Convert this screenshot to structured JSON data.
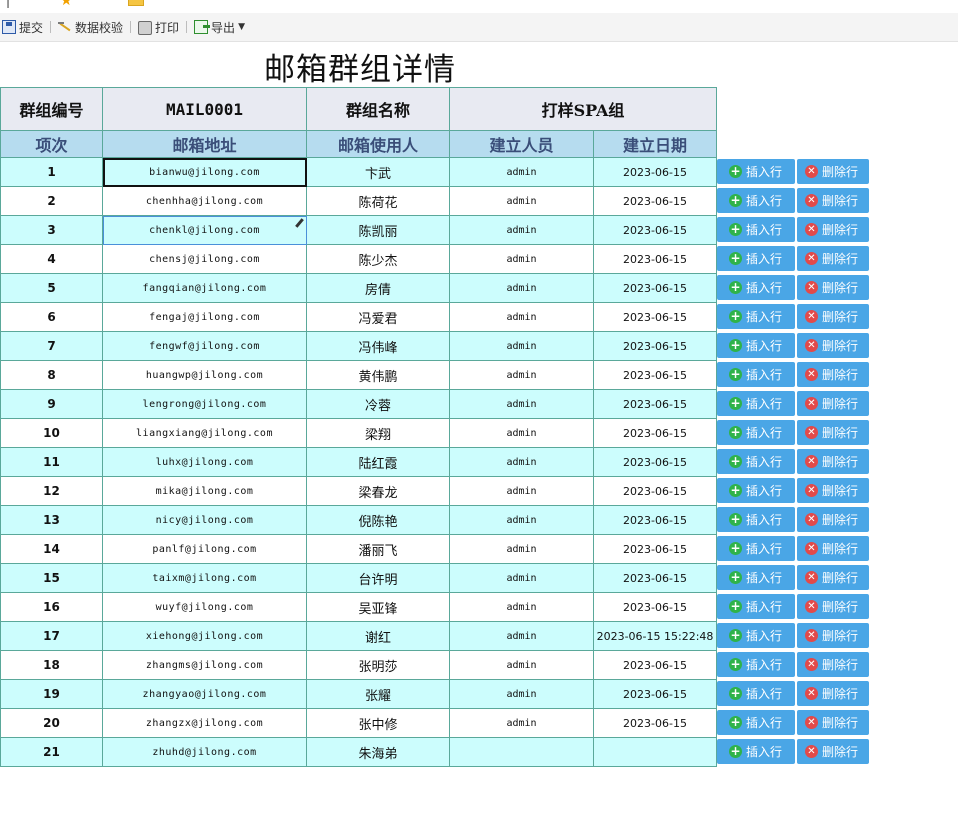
{
  "toolbar": {
    "submit_label": "提交",
    "validate_label": "数据校验",
    "print_label": "打印",
    "export_label": "导出"
  },
  "page_title": "邮箱群组详情",
  "group": {
    "id_label": "群组编号",
    "id_value": "MAIL0001",
    "name_label": "群组名称",
    "name_value": "打样SPA组"
  },
  "columns": [
    "项次",
    "邮箱地址",
    "邮箱使用人",
    "建立人员",
    "建立日期"
  ],
  "rows": [
    {
      "idx": "1",
      "email": "bianwu@jilong.com",
      "user": "卞武",
      "creator": "admin",
      "date": "2023-06-15"
    },
    {
      "idx": "2",
      "email": "chenhha@jilong.com",
      "user": "陈荷花",
      "creator": "admin",
      "date": "2023-06-15"
    },
    {
      "idx": "3",
      "email": "chenkl@jilong.com",
      "user": "陈凯丽",
      "creator": "admin",
      "date": "2023-06-15"
    },
    {
      "idx": "4",
      "email": "chensj@jilong.com",
      "user": "陈少杰",
      "creator": "admin",
      "date": "2023-06-15"
    },
    {
      "idx": "5",
      "email": "fangqian@jilong.com",
      "user": "房倩",
      "creator": "admin",
      "date": "2023-06-15"
    },
    {
      "idx": "6",
      "email": "fengaj@jilong.com",
      "user": "冯爱君",
      "creator": "admin",
      "date": "2023-06-15"
    },
    {
      "idx": "7",
      "email": "fengwf@jilong.com",
      "user": "冯伟峰",
      "creator": "admin",
      "date": "2023-06-15"
    },
    {
      "idx": "8",
      "email": "huangwp@jilong.com",
      "user": "黄伟鹏",
      "creator": "admin",
      "date": "2023-06-15"
    },
    {
      "idx": "9",
      "email": "lengrong@jilong.com",
      "user": "冷蓉",
      "creator": "admin",
      "date": "2023-06-15"
    },
    {
      "idx": "10",
      "email": "liangxiang@jilong.com",
      "user": "梁翔",
      "creator": "admin",
      "date": "2023-06-15"
    },
    {
      "idx": "11",
      "email": "luhx@jilong.com",
      "user": "陆红霞",
      "creator": "admin",
      "date": "2023-06-15"
    },
    {
      "idx": "12",
      "email": "mika@jilong.com",
      "user": "梁春龙",
      "creator": "admin",
      "date": "2023-06-15"
    },
    {
      "idx": "13",
      "email": "nicy@jilong.com",
      "user": "倪陈艳",
      "creator": "admin",
      "date": "2023-06-15"
    },
    {
      "idx": "14",
      "email": "panlf@jilong.com",
      "user": "潘丽飞",
      "creator": "admin",
      "date": "2023-06-15"
    },
    {
      "idx": "15",
      "email": "taixm@jilong.com",
      "user": "台许明",
      "creator": "admin",
      "date": "2023-06-15"
    },
    {
      "idx": "16",
      "email": "wuyf@jilong.com",
      "user": "吴亚锋",
      "creator": "admin",
      "date": "2023-06-15"
    },
    {
      "idx": "17",
      "email": "xiehong@jilong.com",
      "user": "谢红",
      "creator": "admin",
      "date": "2023-06-15 15:22:48"
    },
    {
      "idx": "18",
      "email": "zhangms@jilong.com",
      "user": "张明莎",
      "creator": "admin",
      "date": "2023-06-15"
    },
    {
      "idx": "19",
      "email": "zhangyao@jilong.com",
      "user": "张耀",
      "creator": "admin",
      "date": "2023-06-15"
    },
    {
      "idx": "20",
      "email": "zhangzx@jilong.com",
      "user": "张中修",
      "creator": "admin",
      "date": "2023-06-15"
    },
    {
      "idx": "21",
      "email": "zhuhd@jilong.com",
      "user": "朱海弟",
      "creator": "",
      "date": ""
    }
  ],
  "actions": {
    "insert_label": "插入行",
    "delete_label": "删除行"
  },
  "colors": {
    "odd_row": "#ccfdfd",
    "header_bg": "#b6dcef",
    "button_bg": "#4aa6e6"
  }
}
